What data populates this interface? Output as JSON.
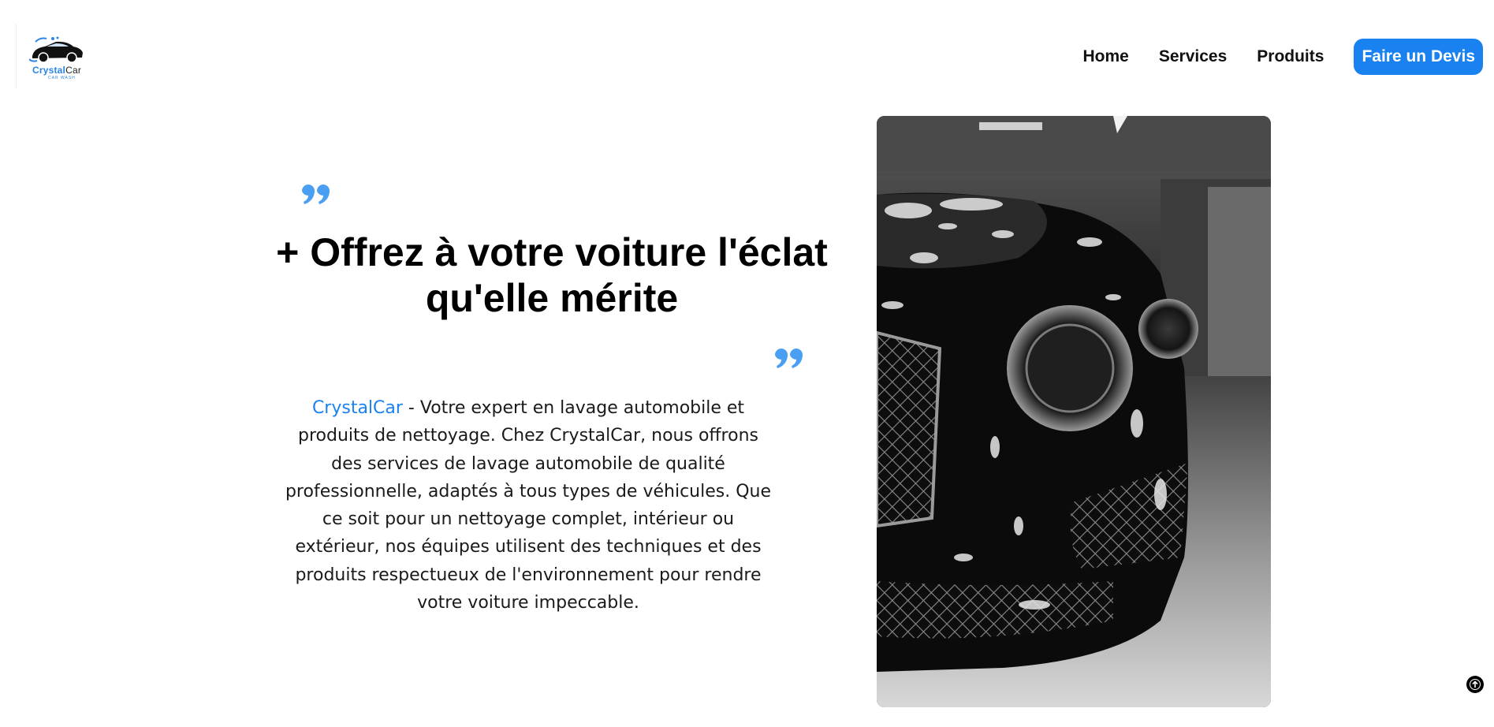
{
  "brand": {
    "name_part1": "Crystal",
    "name_part2": "Car",
    "tagline": "CAR WASH",
    "accent_color": "#1a82f0"
  },
  "nav": {
    "items": [
      {
        "label": "Home"
      },
      {
        "label": "Services"
      },
      {
        "label": "Produits"
      }
    ],
    "cta_label": "Faire un Devis"
  },
  "hero": {
    "headline_line1": "+ Offrez à votre voiture l'éclat",
    "headline_line2": "qu'elle mérite",
    "brand_highlight": "CrystalCar",
    "description": " - Votre expert en lavage automobile et produits de nettoyage. Chez CrystalCar, nous offrons des services de lavage automobile de qualité professionnelle, adaptés à tous types de véhicules. Que ce soit pour un nettoyage complet, intérieur ou extérieur, nos équipes utilisent des techniques et des produits respectueux de l'environnement pour rendre votre voiture impeccable.",
    "image_icon": "foam-covered-car-photo"
  },
  "icons": {
    "quote": "quote-icon",
    "scroll_top": "arrow-up-icon"
  }
}
